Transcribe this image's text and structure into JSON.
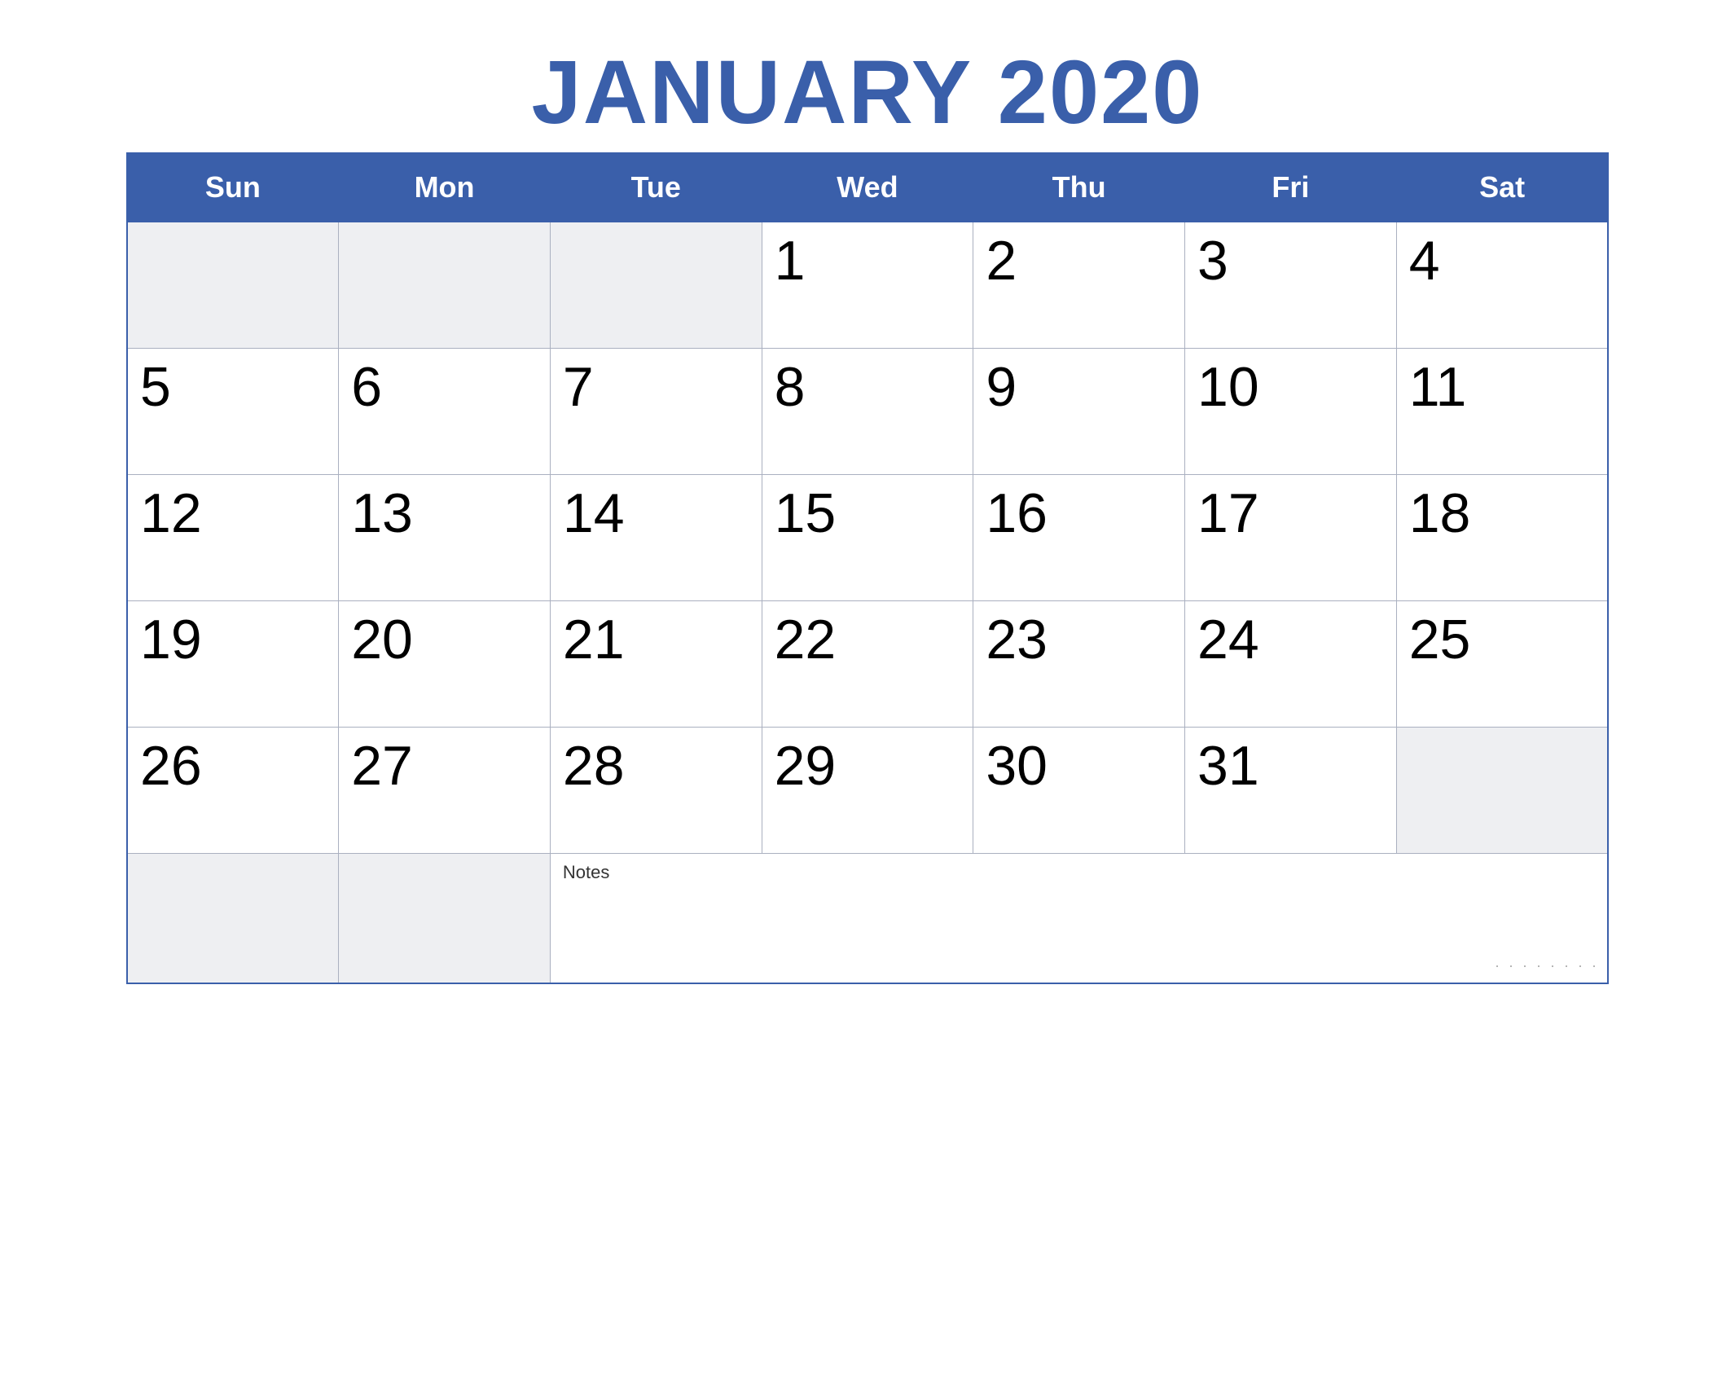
{
  "header": {
    "title": "JANUARY 2020"
  },
  "weekdays": [
    "Sun",
    "Mon",
    "Tue",
    "Wed",
    "Thu",
    "Fri",
    "Sat"
  ],
  "weeks": [
    [
      null,
      null,
      null,
      1,
      2,
      3,
      4
    ],
    [
      5,
      6,
      7,
      8,
      9,
      10,
      11
    ],
    [
      12,
      13,
      14,
      15,
      16,
      17,
      18
    ],
    [
      19,
      20,
      21,
      22,
      23,
      24,
      25
    ],
    [
      26,
      27,
      28,
      29,
      30,
      31,
      null
    ]
  ],
  "notes": {
    "label": "Notes",
    "dots": "· · · · · · · ·"
  },
  "colors": {
    "header_bg": "#3a5faa",
    "header_text": "#ffffff",
    "title_color": "#3a5faa",
    "empty_cell_bg": "#eeeff2",
    "border_color": "#aab0c0"
  }
}
